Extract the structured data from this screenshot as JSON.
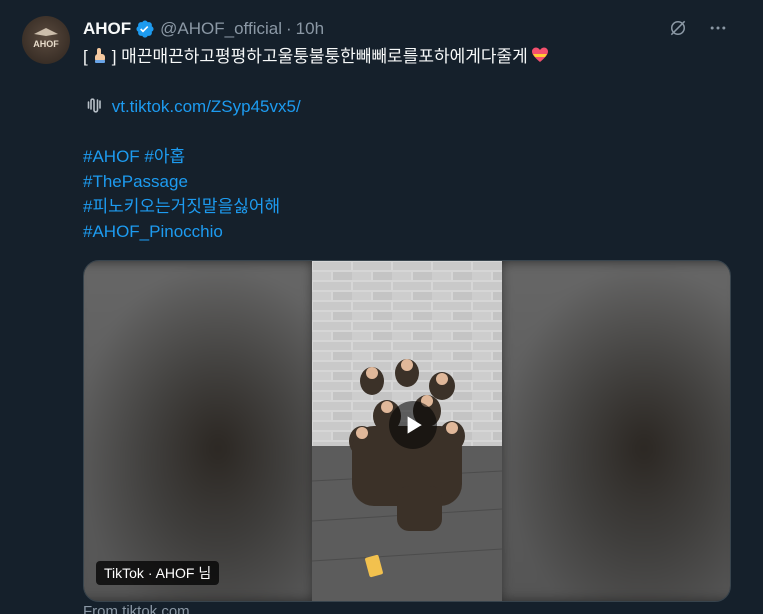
{
  "tweet": {
    "author": {
      "display_name": "AHOF",
      "handle": "@AHOF_official",
      "verified": true,
      "avatar_text": "AHOF"
    },
    "separator": "·",
    "time": "10h",
    "text": {
      "line1_open": "[",
      "line1_close": "] 매끈매끈하고평평하고울퉁불퉁한빼빼로를포하에게다줄게",
      "link": "vt.tiktok.com/ZSyp45vx5/",
      "hashtags": [
        "#AHOF #아홉",
        "#ThePassage",
        "#피노키오는거짓말을싫어해",
        "#AHOF_Pinocchio"
      ]
    },
    "media": {
      "source_label": "TikTok · AHOF 님",
      "from_text": "From tiktok.com"
    },
    "icons": {
      "grok": "grok-icon",
      "more": "more-icon",
      "verified": "verified-badge-icon",
      "link": "paperclip-icon",
      "play": "play-icon"
    },
    "colors": {
      "background": "#15202b",
      "accent": "#1d9bf0",
      "secondary_text": "#8b98a5"
    }
  }
}
